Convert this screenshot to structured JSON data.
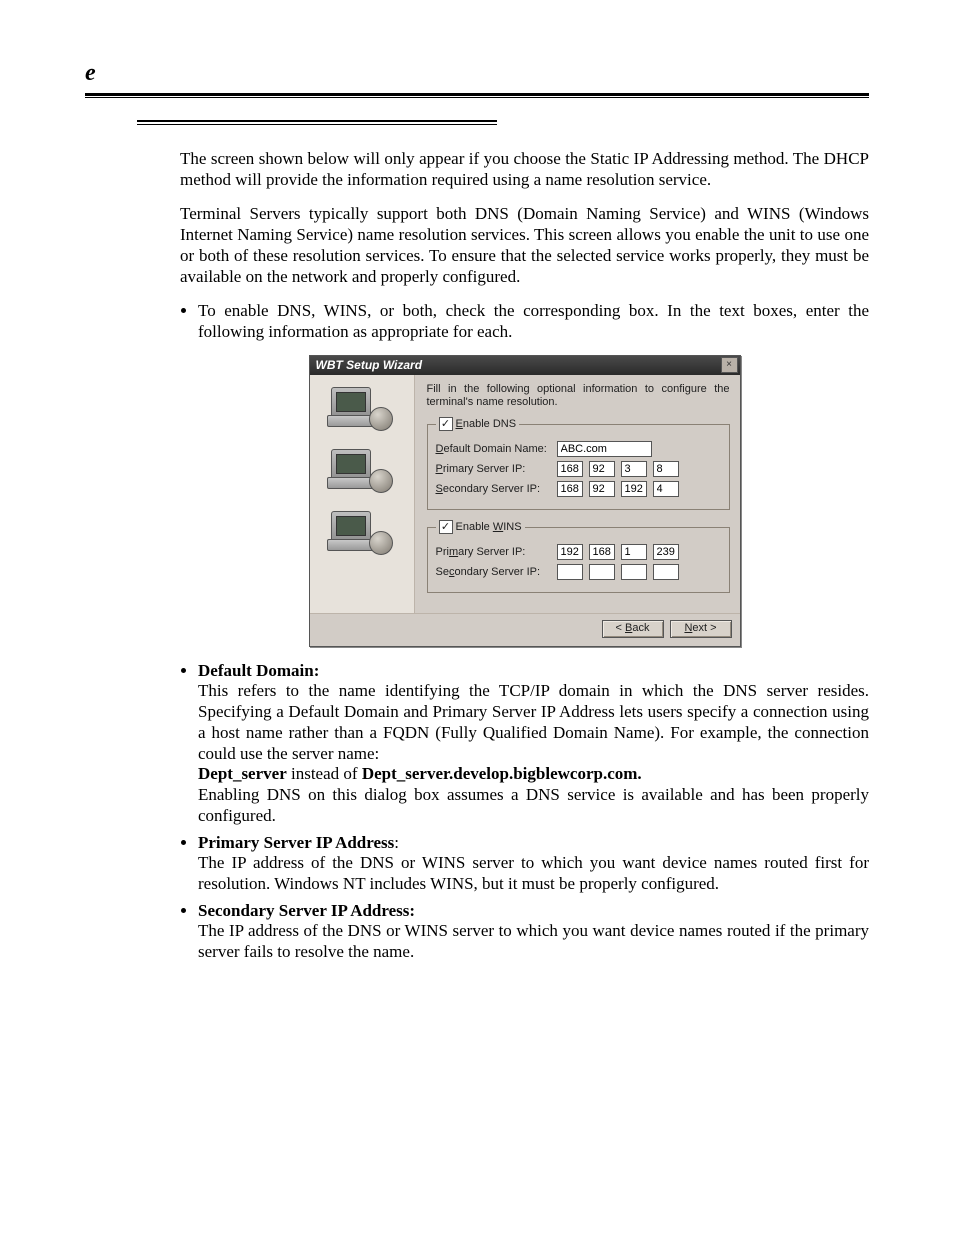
{
  "header": {
    "letter": "e"
  },
  "intro": {
    "p1": "The screen shown below will only appear if you choose the Static IP Addressing method. The DHCP method will provide the information required using a name resolution service.",
    "p2": "Terminal Servers typically support both DNS (Domain Naming Service) and WINS (Windows Internet Naming Service) name resolution services. This screen allows you enable the unit to use one or both of these resolution services. To ensure that the selected service works properly, they must be available on the network and properly configured.",
    "bullet1": "To enable DNS, WINS, or both, check the corresponding box. In the text boxes, enter the following information as appropriate for each."
  },
  "wizard": {
    "title": "WBT Setup Wizard",
    "instruction": "Fill in the following optional information to configure the terminal's name resolution.",
    "dns": {
      "legend_prefix": "E",
      "legend_rest": "nable DNS",
      "default_domain_label_pre": "D",
      "default_domain_label_rest": "efault Domain Name:",
      "default_domain_value": "ABC.com",
      "primary_label_pre": "P",
      "primary_label_rest": "rimary Server IP:",
      "primary_ip": [
        "168",
        "92",
        "3",
        "8"
      ],
      "secondary_label_pre": "S",
      "secondary_label_rest": "econdary Server IP:",
      "secondary_ip": [
        "168",
        "92",
        "192",
        "4"
      ]
    },
    "wins": {
      "legend_prefix": "Enable ",
      "legend_u": "W",
      "legend_rest": "INS",
      "primary_label": "Pri",
      "primary_label_u": "m",
      "primary_label_rest": "ary Server IP:",
      "primary_ip": [
        "192",
        "168",
        "1",
        "239"
      ],
      "secondary_label": "Se",
      "secondary_label_u": "c",
      "secondary_label_rest": "ondary Server IP:",
      "secondary_ip": [
        "",
        "",
        "",
        ""
      ]
    },
    "buttons": {
      "back": "< Back",
      "next": "Next >",
      "back_u": "B",
      "next_u": "N"
    }
  },
  "definitions": {
    "dd": {
      "title": "Default Domain:",
      "body1": "This refers to the name identifying the TCP/IP domain in which the DNS server resides. Specifying a Default Domain and Primary Server IP Address lets users specify a connection using a host name rather than a FQDN (Fully Qualified Domain Name). For example, the connection could use the server name:",
      "bold_a": "Dept_server",
      "mid": " instead of ",
      "bold_b": "Dept_server.develop.bigblewcorp.com.",
      "body2": "Enabling DNS on this dialog box assumes a DNS service is available and has been properly configured."
    },
    "ps": {
      "title": "Primary Server IP Address",
      "body": "The IP address of the DNS or WINS server to which you want device names routed first for resolution. Windows NT includes WINS, but it must be properly configured."
    },
    "ss": {
      "title": "Secondary Server IP Address:",
      "body": "The IP address of the DNS or WINS server to which you want device names routed if the primary server fails to resolve the name."
    }
  }
}
